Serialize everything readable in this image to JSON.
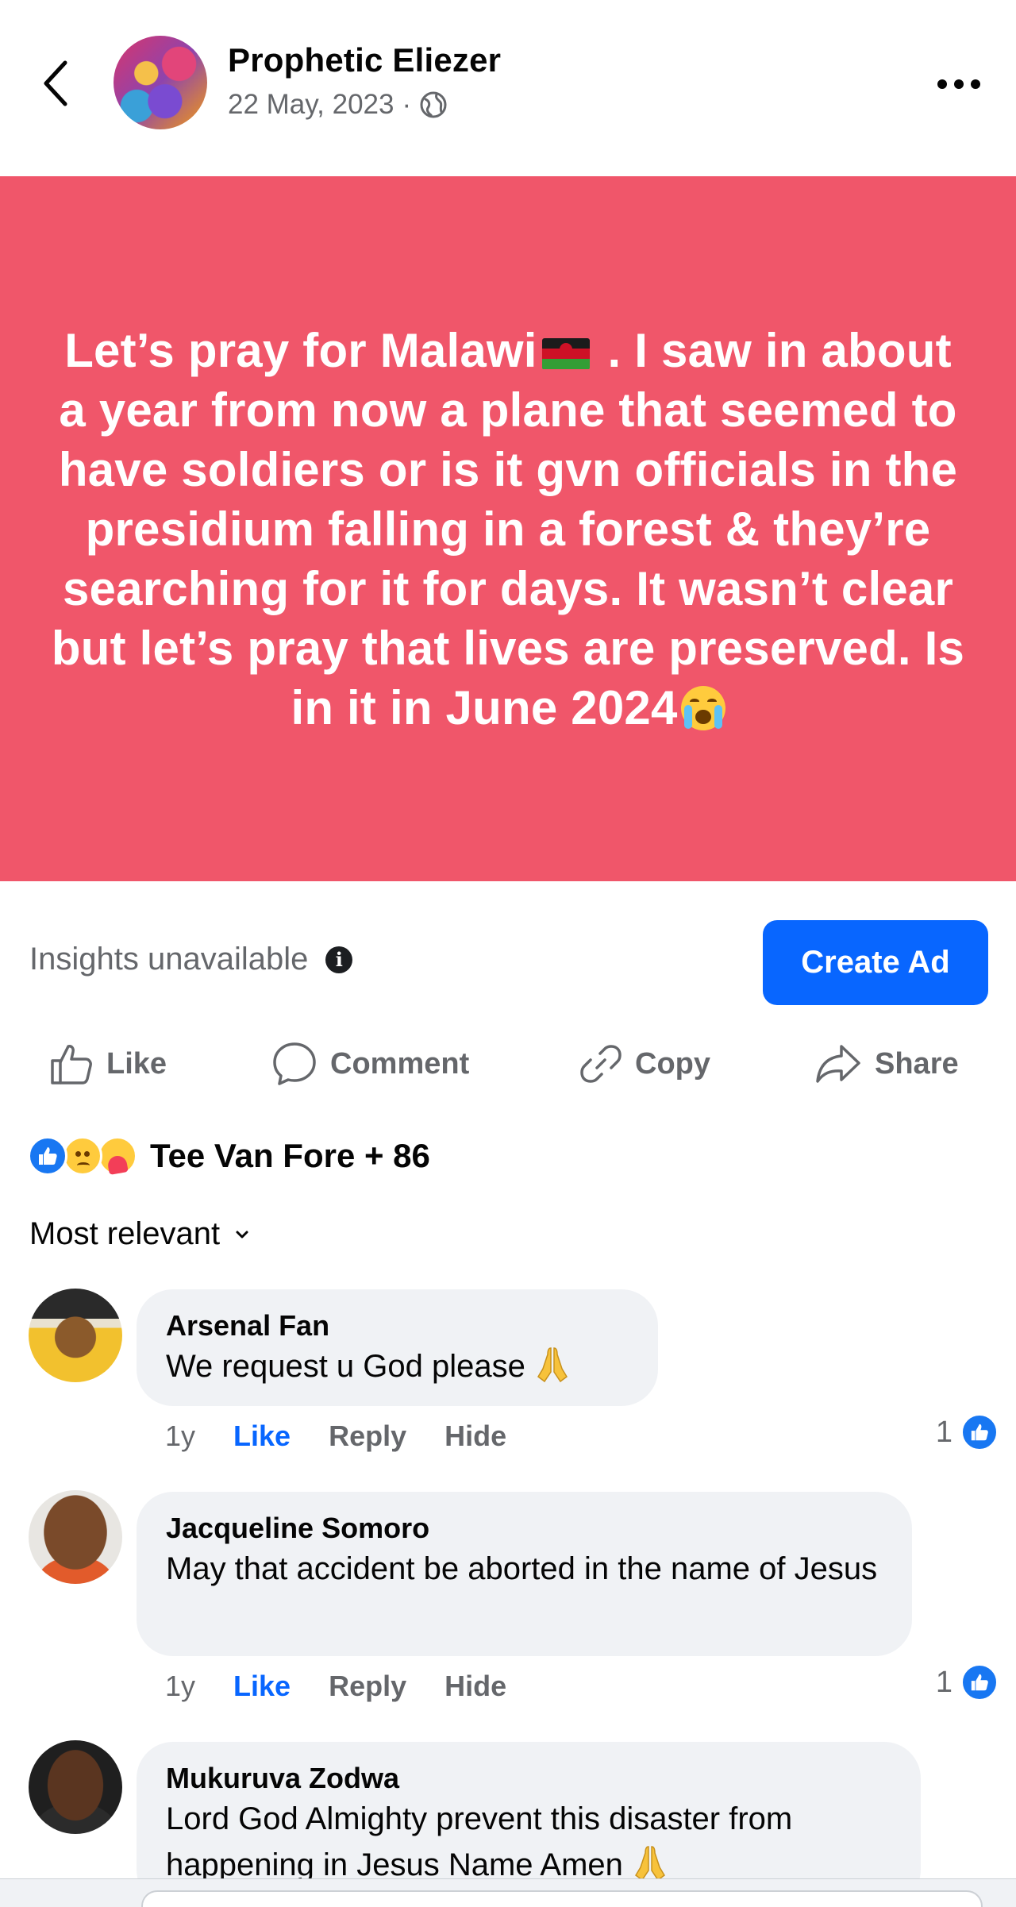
{
  "header": {
    "author_name": "Prophetic Eliezer",
    "date": "22 May, 2023",
    "separator": "·",
    "privacy_icon": "globe-icon",
    "back_icon": "chevron-left-icon",
    "more_icon": "more-horizontal-icon"
  },
  "post": {
    "background_color": "#f0566a",
    "text_part1": "Let’s pray for Malawi",
    "text_part2": " . I saw in about a year from now a plane that seemed to have soldiers or is it gvn officials in the presidium falling in a forest & they’re searching for it for days. It wasn’t clear but let’s pray that lives are preserved. Is in it in June 2024",
    "flag_icon": "malawi-flag-icon",
    "emoji_icon": "loudly-crying-face-icon"
  },
  "insights": {
    "label": "Insights unavailable",
    "info_icon": "info-icon",
    "create_ad_label": "Create Ad",
    "accent_color": "#0866ff"
  },
  "actions": {
    "like": "Like",
    "comment": "Comment",
    "copy": "Copy",
    "share": "Share"
  },
  "reactions": {
    "icons": [
      "like-reaction-icon",
      "sad-reaction-icon",
      "care-reaction-icon"
    ],
    "summary": "Tee Van Fore + 86"
  },
  "sort": {
    "label": "Most relevant",
    "icon": "chevron-down-icon"
  },
  "comments": [
    {
      "name": "Arsenal Fan",
      "text": "We request u God please",
      "emoji": "folded-hands-icon",
      "time": "1y",
      "like": "Like",
      "reply": "Reply",
      "hide": "Hide",
      "like_count": "1"
    },
    {
      "name": "Jacqueline Somoro",
      "text": "May that accident be aborted in the name of Jesus",
      "time": "1y",
      "like": "Like",
      "reply": "Reply",
      "hide": "Hide",
      "like_count": "1"
    },
    {
      "name": "Mukuruva Zodwa",
      "text": "Lord God Almighty prevent this disaster from happening in Jesus Name Amen",
      "emoji": "folded-hands-icon"
    }
  ]
}
